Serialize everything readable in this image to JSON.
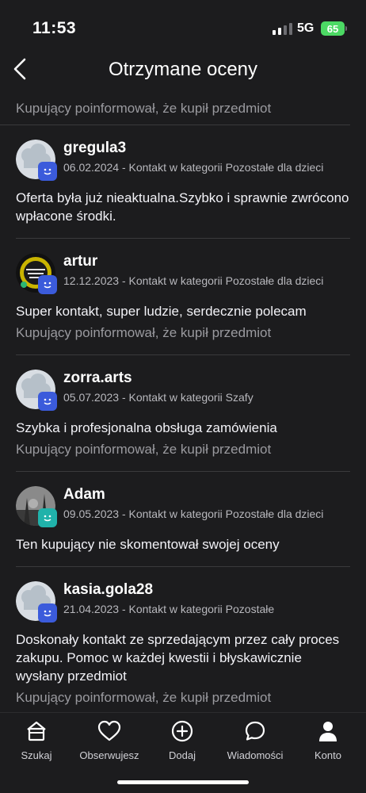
{
  "status_bar": {
    "time": "11:53",
    "network": "5G",
    "battery": "65"
  },
  "header": {
    "title": "Otrzymane oceny",
    "back_icon": "chevron-left-icon"
  },
  "partial_review": {
    "note": "Kupujący poinformował, że kupił przedmiot"
  },
  "reviews": [
    {
      "name": "gregula3",
      "meta": "06.02.2024 - Kontakt w kategorii Pozostałe dla dzieci",
      "text": "Oferta była już nieaktualna.Szybko i sprawnie zwrócono wpłacone środki.",
      "note": "",
      "badge_color": "#3b5bdb"
    },
    {
      "name": "artur",
      "meta": "12.12.2023 - Kontakt w kategorii Pozostałe dla dzieci",
      "text": "Super kontakt, super ludzie, serdecznie polecam",
      "note": "Kupujący poinformował, że kupił przedmiot",
      "badge_color": "#3b5bdb"
    },
    {
      "name": "zorra.arts",
      "meta": "05.07.2023 - Kontakt w kategorii Szafy",
      "text": "Szybka i profesjonalna obsługa zamówienia",
      "note": "Kupujący poinformował, że kupił przedmiot",
      "badge_color": "#3b5bdb"
    },
    {
      "name": "Adam",
      "meta": "09.05.2023 - Kontakt w kategorii Pozostałe dla dzieci",
      "text": "Ten kupujący nie skomentował swojej oceny",
      "note": "",
      "badge_color": "#20b2aa"
    },
    {
      "name": "kasia.gola28",
      "meta": "21.04.2023 - Kontakt w kategorii Pozostałe",
      "text": "Doskonały kontakt ze sprzedającym przez cały proces zakupu. Pomoc w każdej kwestii i błyskawicznie wysłany przedmiot",
      "note": "Kupujący poinformował, że kupił przedmiot",
      "badge_color": "#3b5bdb"
    }
  ],
  "bottom_nav": {
    "items": [
      {
        "label": "Szukaj",
        "icon": "home-icon"
      },
      {
        "label": "Obserwujesz",
        "icon": "heart-icon"
      },
      {
        "label": "Dodaj",
        "icon": "plus-circle-icon"
      },
      {
        "label": "Wiadomości",
        "icon": "chat-bubble-icon"
      },
      {
        "label": "Konto",
        "icon": "user-icon"
      }
    ]
  },
  "colors": {
    "background": "#1c1c1e",
    "battery_green": "#4cd964",
    "secondary_text": "#9a9a9f"
  }
}
